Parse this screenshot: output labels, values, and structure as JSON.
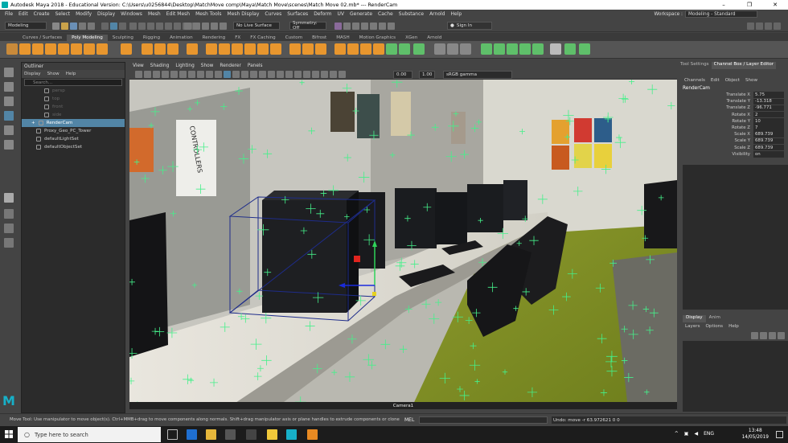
{
  "window": {
    "title": "Autodesk Maya 2018 - Educational Version: C:\\Users\\u0256844\\Desktop\\MatchMove comp\\Maya\\Match Move\\scenes\\Match Move 02.mb*  ---  RenderCam",
    "minimize": "–",
    "maximize": "❐",
    "close": "✕"
  },
  "menubar": [
    "File",
    "Edit",
    "Create",
    "Select",
    "Modify",
    "Display",
    "Windows",
    "Mesh",
    "Edit Mesh",
    "Mesh Tools",
    "Mesh Display",
    "Curves",
    "Surfaces",
    "Deform",
    "UV",
    "Generate",
    "Cache",
    "Substance",
    "Arnold",
    "Help"
  ],
  "workspace": {
    "label": "Workspace :",
    "value": "Modeling - Standard"
  },
  "statusline": {
    "mode": "Modeling",
    "live_surface": "No Live Surface",
    "symmetry": "Symmetry: Off",
    "sign_in": "Sign In"
  },
  "shelf_tabs": [
    "Curves / Surfaces",
    "Poly Modeling",
    "Sculpting",
    "Rigging",
    "Animation",
    "Rendering",
    "FX",
    "FX Caching",
    "Custom",
    "Bifrost",
    "MASH",
    "Motion Graphics",
    "XGen",
    "Arnold"
  ],
  "shelf_active": "Poly Modeling",
  "outliner": {
    "title": "Outliner",
    "menu": [
      "Display",
      "Show",
      "Help"
    ],
    "search_placeholder": "Search...",
    "items": [
      {
        "label": "persp",
        "state": "dim"
      },
      {
        "label": "top",
        "state": "dim"
      },
      {
        "label": "front",
        "state": "dim"
      },
      {
        "label": "side",
        "state": "dim"
      },
      {
        "label": "RenderCam",
        "state": "sel"
      },
      {
        "label": "Proxy_Geo_PC_Tower",
        "state": "normal"
      },
      {
        "label": "defaultLightSet",
        "state": "normal"
      },
      {
        "label": "defaultObjectSet",
        "state": "normal"
      }
    ]
  },
  "viewport": {
    "menu": [
      "View",
      "Shading",
      "Lighting",
      "Show",
      "Renderer",
      "Panels"
    ],
    "exposure": "0.00",
    "gamma": "1.00",
    "colorspace": "sRGB gamma",
    "camera_label": "Camera1"
  },
  "channel_box": {
    "tabs": [
      "Tool Settings",
      "Channel Box / Layer Editor"
    ],
    "menu": [
      "Channels",
      "Edit",
      "Object",
      "Show"
    ],
    "object": "RenderCam",
    "attributes": [
      {
        "name": "Translate X",
        "value": "5.75"
      },
      {
        "name": "Translate Y",
        "value": "-13.318"
      },
      {
        "name": "Translate Z",
        "value": "-96.771"
      },
      {
        "name": "Rotate X",
        "value": "2"
      },
      {
        "name": "Rotate Y",
        "value": "10"
      },
      {
        "name": "Rotate Z",
        "value": "7"
      },
      {
        "name": "Scale X",
        "value": "689.739"
      },
      {
        "name": "Scale Y",
        "value": "689.739"
      },
      {
        "name": "Scale Z",
        "value": "689.739"
      },
      {
        "name": "Visibility",
        "value": "on"
      }
    ]
  },
  "layer_editor": {
    "tabs": [
      "Display",
      "Anim"
    ],
    "menu": [
      "Layers",
      "Options",
      "Help"
    ]
  },
  "helpline": {
    "text": "Move Tool: Use manipulator to move object(s). Ctrl+MMB+drag to move components along normals. Shift+drag manipulator axis or plane handles to extrude components or clone objects. Ctrl+Shift+LMB+drag to",
    "mel_label": "MEL",
    "result": "Undo: move -r 63.972621 0 0"
  },
  "taskbar": {
    "search_placeholder": "Type here to search",
    "lang": "ENG",
    "time": "13:48",
    "date": "14/05/2019"
  },
  "colors": {
    "accent_select": "#5285a6",
    "shelf_orange": "#e8962e",
    "shelf_green": "#5fbf6a",
    "track_green": "#45f08a"
  },
  "poster_text": "CONTROLLERS"
}
